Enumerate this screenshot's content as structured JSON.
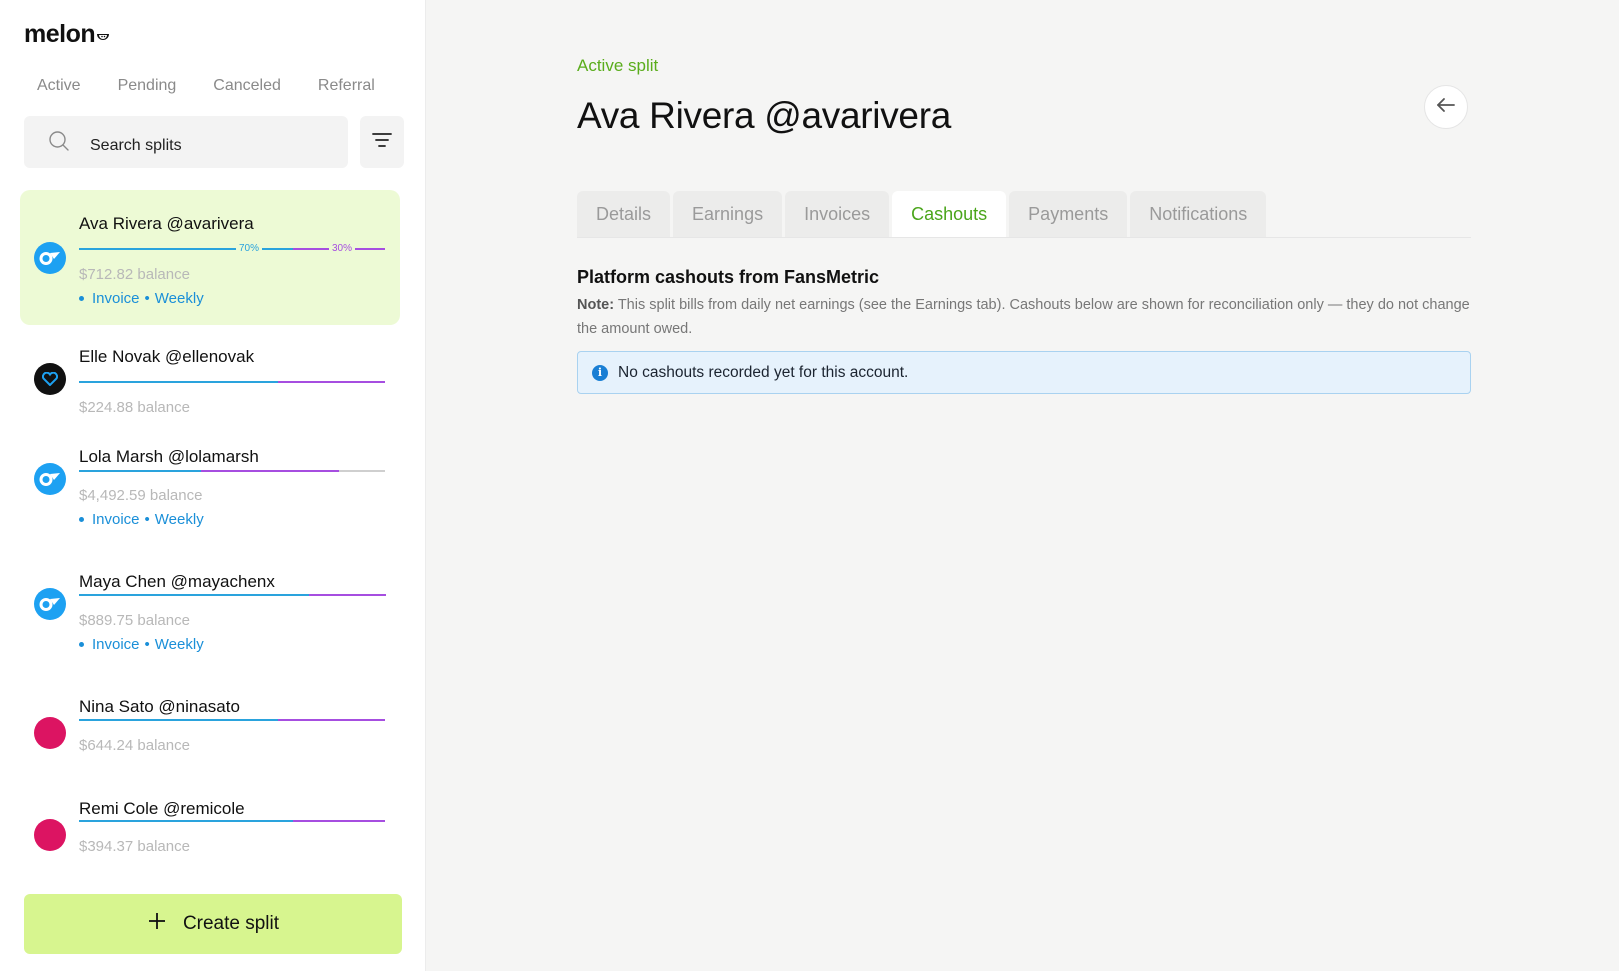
{
  "app": {
    "logo": "melon",
    "logo_mark": "🍉"
  },
  "sidebar": {
    "status_tabs": [
      {
        "label": "Active",
        "active": true
      },
      {
        "label": "Pending",
        "active": false
      },
      {
        "label": "Canceled",
        "active": false
      },
      {
        "label": "Referral",
        "active": false
      }
    ],
    "search": {
      "placeholder": "Search splits"
    },
    "splits": [
      {
        "name": "Ava Rivera @avarivera",
        "balance": "$712.82 balance",
        "split_a": 0.7,
        "split_b": 0.3,
        "pct_a": "70%",
        "pct_b": "30%",
        "meta": {
          "type": "Invoice",
          "sep": "•",
          "frequency": "Weekly"
        },
        "avatar": "onlyfans-icon",
        "selected": true
      },
      {
        "name": "Elle Novak @ellenovak",
        "balance": "$224.88 balance",
        "split_a": 0.65,
        "split_b": 0.35,
        "avatar": "fansly-icon",
        "selected": false
      },
      {
        "name": "Lola Marsh @lolamarsh",
        "balance": "$4,492.59 balance",
        "split_a": 0.4,
        "split_b": 0.45,
        "meta": {
          "type": "Invoice",
          "sep": "•",
          "frequency": "Weekly"
        },
        "avatar": "onlyfans-icon",
        "selected": false
      },
      {
        "name": "Maya Chen @mayachenx",
        "balance": "$889.75 balance",
        "split_a": 0.75,
        "split_b": 0.25,
        "meta": {
          "type": "Invoice",
          "sep": "•",
          "frequency": "Weekly"
        },
        "avatar": "onlyfans-icon",
        "selected": false
      },
      {
        "name": "Nina Sato @ninasato",
        "balance": "$644.24 balance",
        "split_a": 0.65,
        "split_b": 0.35,
        "avatar": "pink-avatar",
        "selected": false
      },
      {
        "name": "Remi Cole @remicole",
        "balance": "$394.37 balance",
        "split_a": 0.7,
        "split_b": 0.3,
        "avatar": "pink-avatar",
        "selected": false
      }
    ],
    "create_label": "Create split"
  },
  "main": {
    "kicker": "Active split",
    "title": "Ava Rivera @avarivera",
    "tabs": [
      {
        "label": "Details",
        "active": false
      },
      {
        "label": "Earnings",
        "active": false
      },
      {
        "label": "Invoices",
        "active": false
      },
      {
        "label": "Cashouts",
        "active": true
      },
      {
        "label": "Payments",
        "active": false
      },
      {
        "label": "Notifications",
        "active": false
      }
    ],
    "section_title": "Platform cashouts from FansMetric",
    "note_label": "Note:",
    "note_text": " This split bills from daily net earnings (see the Earnings tab). Cashouts below are shown for reconciliation only — they do not change the amount owed.",
    "info_text": "No cashouts recorded yet for this account."
  },
  "colors": {
    "accent_green": "#5aad1c",
    "create_bg": "#d7f58f",
    "selected_bg": "#edfad5",
    "split_blue": "#2aa3dd",
    "split_purple": "#a64ee0",
    "info_bg": "#e6f2fc"
  }
}
